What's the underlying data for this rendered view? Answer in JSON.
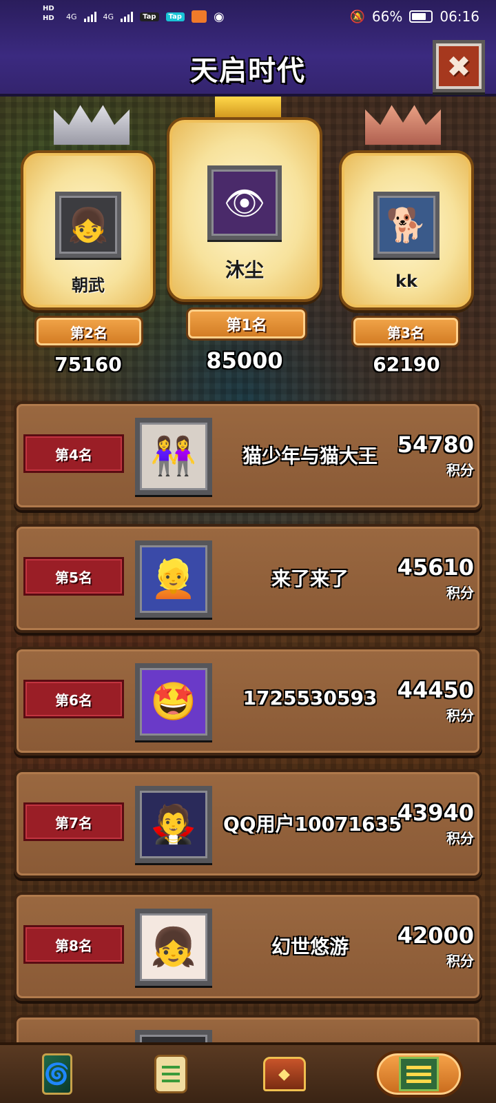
{
  "status_bar": {
    "hd1": "HD",
    "hd2": "HD",
    "net1": "4G",
    "net2": "4G",
    "app1": "Tap",
    "app2": "Tap",
    "battery": "66%",
    "time": "06:16"
  },
  "header": {
    "title": "天启时代",
    "close_glyph": "✖"
  },
  "podium": [
    {
      "rank_label": "第2名",
      "name": "朝武",
      "score": "75160",
      "avatar_icon": "anime-girl-avatar",
      "crown": "silver"
    },
    {
      "rank_label": "第1名",
      "name": "沐尘",
      "score": "85000",
      "avatar_icon": "purple-eye-avatar",
      "crown": "gold"
    },
    {
      "rank_label": "第3名",
      "name": "kk",
      "score": "62190",
      "avatar_icon": "shiba-dog-avatar",
      "crown": "bronze"
    }
  ],
  "rankings": [
    {
      "rank_label": "第4名",
      "name": "猫少年与猫大王",
      "score": "54780",
      "unit": "积分",
      "avatar_icon": "photo-avatar"
    },
    {
      "rank_label": "第5名",
      "name": "来了来了",
      "score": "45610",
      "unit": "积分",
      "avatar_icon": "blonde-cartoon-avatar"
    },
    {
      "rank_label": "第6名",
      "name": "1725530593",
      "score": "44450",
      "unit": "积分",
      "avatar_icon": "star-eyes-cartoon-avatar"
    },
    {
      "rank_label": "第7名",
      "name": "QQ用户10071635",
      "score": "43940",
      "unit": "积分",
      "avatar_icon": "anime-dark-hair-avatar"
    },
    {
      "rank_label": "第8名",
      "name": "幻世悠游",
      "score": "42000",
      "unit": "积分",
      "avatar_icon": "anime-girl-avatar"
    }
  ],
  "bottom_nav": [
    {
      "icon": "card-deck-icon",
      "active": false
    },
    {
      "icon": "quest-scroll-icon",
      "active": false
    },
    {
      "icon": "treasure-chest-icon",
      "active": false
    },
    {
      "icon": "leaderboard-icon",
      "active": true
    }
  ],
  "colors": {
    "header_bg": "#3b2a80",
    "rank_tag": "#9a1e26",
    "row_bg": "#8a5a36",
    "podium_scroll": "#f7e29c"
  }
}
